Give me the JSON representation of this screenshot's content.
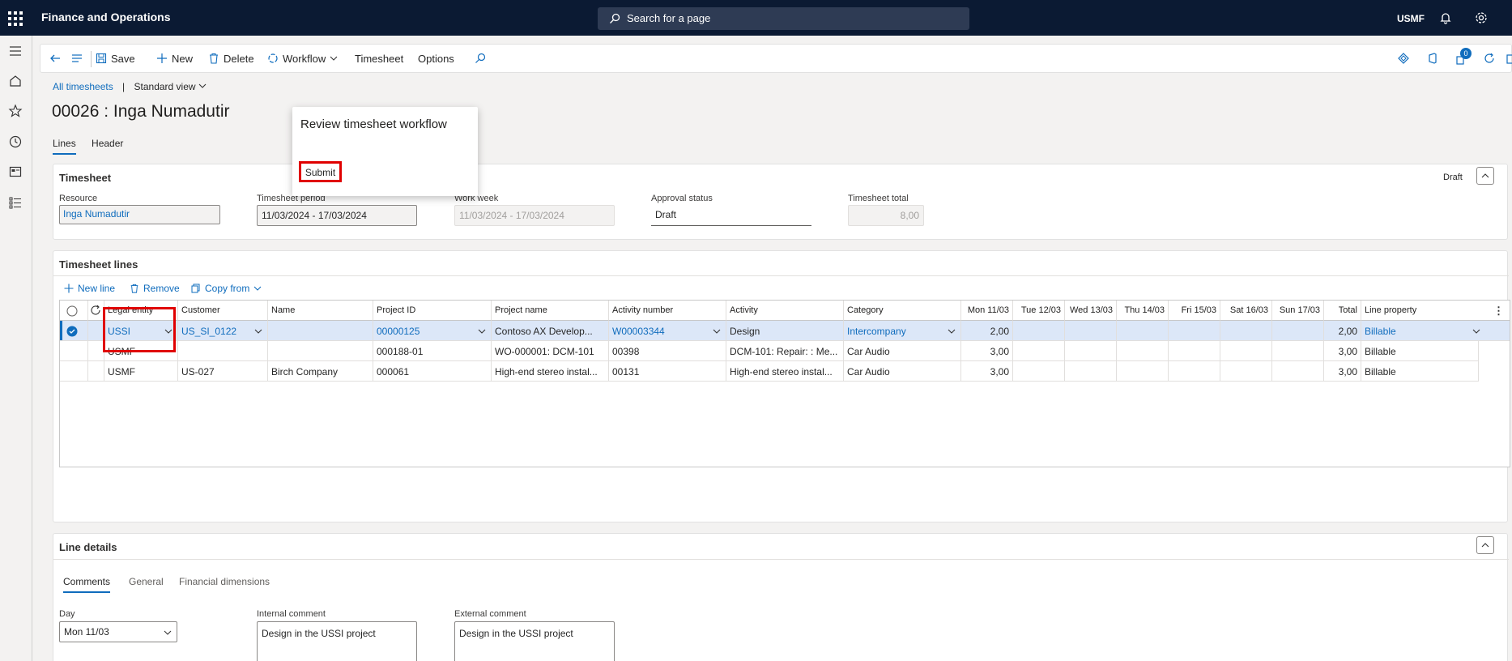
{
  "topbar": {
    "app_title": "Finance and Operations",
    "search_placeholder": "Search for a page",
    "company": "USMF"
  },
  "actions": {
    "save": "Save",
    "new": "New",
    "delete": "Delete",
    "workflow": "Workflow",
    "timesheet": "Timesheet",
    "options": "Options",
    "badge_count": "0"
  },
  "breadcrumb": {
    "all": "All timesheets",
    "separator": "|",
    "view": "Standard view"
  },
  "page_title": "00026 : Inga Numadutir",
  "page_tabs": [
    "Lines",
    "Header"
  ],
  "workflow_flyout": {
    "title": "Review timesheet workflow",
    "submit": "Submit"
  },
  "timesheet_card": {
    "title": "Timesheet",
    "status": "Draft",
    "fields": {
      "resource_label": "Resource",
      "resource_value": "Inga Numadutir",
      "period_label": "Timesheet period",
      "period_value": "11/03/2024 - 17/03/2024",
      "workweek_label": "Work week",
      "workweek_value": "11/03/2024 - 17/03/2024",
      "approval_label": "Approval status",
      "approval_value": "Draft",
      "total_label": "Timesheet total",
      "total_value": "8,00"
    }
  },
  "lines_card": {
    "title": "Timesheet lines",
    "new_line": "New line",
    "remove": "Remove",
    "copy_from": "Copy from",
    "headers": {
      "legal_entity": "Legal entity",
      "customer": "Customer",
      "name": "Name",
      "project_id": "Project ID",
      "project_name": "Project name",
      "activity_number": "Activity number",
      "activity": "Activity",
      "category": "Category",
      "mon": "Mon 11/03",
      "tue": "Tue 12/03",
      "wed": "Wed 13/03",
      "thu": "Thu 14/03",
      "fri": "Fri 15/03",
      "sat": "Sat 16/03",
      "sun": "Sun 17/03",
      "total": "Total",
      "line_property": "Line property"
    },
    "rows": [
      {
        "legal_entity": "USSI",
        "customer": "US_SI_0122",
        "name": "",
        "project_id": "00000125",
        "project_name": "Contoso AX Develop...",
        "activity_number": "W00003344",
        "activity": "Design",
        "category": "Intercompany",
        "mon": "2,00",
        "total": "2,00",
        "line_property": "Billable"
      },
      {
        "legal_entity": "USMF",
        "customer": "",
        "name": "",
        "project_id": "000188-01",
        "project_name": "WO-000001: DCM-101",
        "activity_number": "00398",
        "activity": "DCM-101: Repair: : Me...",
        "category": "Car Audio",
        "mon": "3,00",
        "total": "3,00",
        "line_property": "Billable"
      },
      {
        "legal_entity": "USMF",
        "customer": "US-027",
        "name": "Birch Company",
        "project_id": "000061",
        "project_name": "High-end stereo instal...",
        "activity_number": "00131",
        "activity": "High-end stereo instal...",
        "category": "Car Audio",
        "mon": "3,00",
        "total": "3,00",
        "line_property": "Billable"
      }
    ]
  },
  "line_details": {
    "title": "Line details",
    "tabs": [
      "Comments",
      "General",
      "Financial dimensions"
    ],
    "day_label": "Day",
    "day_value": "Mon 11/03",
    "internal_label": "Internal comment",
    "internal_value": "Design in the USSI project",
    "external_label": "External comment",
    "external_value": "Design in the USSI project"
  },
  "colors": {
    "topbar": "#0b1a33",
    "accent": "#0f6cbd",
    "highlight": "#e00000",
    "selected_row": "#dce7f8"
  }
}
